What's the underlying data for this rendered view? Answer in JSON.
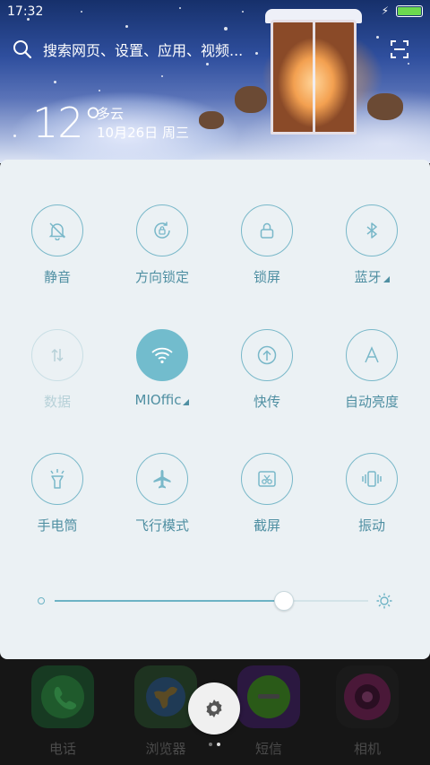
{
  "status_bar": {
    "time": "17:32",
    "battery_level": 1.0
  },
  "search": {
    "placeholder": "搜索网页、设置、应用、视频..."
  },
  "weather": {
    "temperature": "12°",
    "condition": "多云",
    "date": "10月26日 周三"
  },
  "quick_settings": {
    "tiles": [
      {
        "id": "silent",
        "label": "静音",
        "icon": "bell-off-icon",
        "state": "off"
      },
      {
        "id": "rotation-lock",
        "label": "方向锁定",
        "icon": "rotation-lock-icon",
        "state": "off"
      },
      {
        "id": "lock-screen",
        "label": "锁屏",
        "icon": "lock-icon",
        "state": "off"
      },
      {
        "id": "bluetooth",
        "label": "蓝牙",
        "icon": "bluetooth-icon",
        "state": "off",
        "expandable": true
      },
      {
        "id": "data",
        "label": "数据",
        "icon": "data-arrows-icon",
        "state": "disabled"
      },
      {
        "id": "wifi",
        "label": "MIOffic",
        "icon": "wifi-icon",
        "state": "on",
        "expandable": true
      },
      {
        "id": "quick-share",
        "label": "快传",
        "icon": "upload-icon",
        "state": "off"
      },
      {
        "id": "auto-brightness",
        "label": "自动亮度",
        "icon": "letter-a-icon",
        "state": "off"
      },
      {
        "id": "flashlight",
        "label": "手电筒",
        "icon": "flashlight-icon",
        "state": "off"
      },
      {
        "id": "airplane",
        "label": "飞行模式",
        "icon": "airplane-icon",
        "state": "off"
      },
      {
        "id": "screenshot",
        "label": "截屏",
        "icon": "scissors-icon",
        "state": "off"
      },
      {
        "id": "vibrate",
        "label": "振动",
        "icon": "vibrate-icon",
        "state": "off"
      }
    ],
    "brightness": {
      "level": 0.73
    }
  },
  "dock": {
    "apps": [
      {
        "label": "电话",
        "icon": "phone-icon"
      },
      {
        "label": "浏览器",
        "icon": "globe-icon"
      },
      {
        "label": "短信",
        "icon": "message-icon"
      },
      {
        "label": "相机",
        "icon": "camera-icon"
      }
    ]
  },
  "colors": {
    "accent": "#72bccd",
    "panel": "#ebf1f4",
    "tile_label": "#4f8fa2"
  }
}
